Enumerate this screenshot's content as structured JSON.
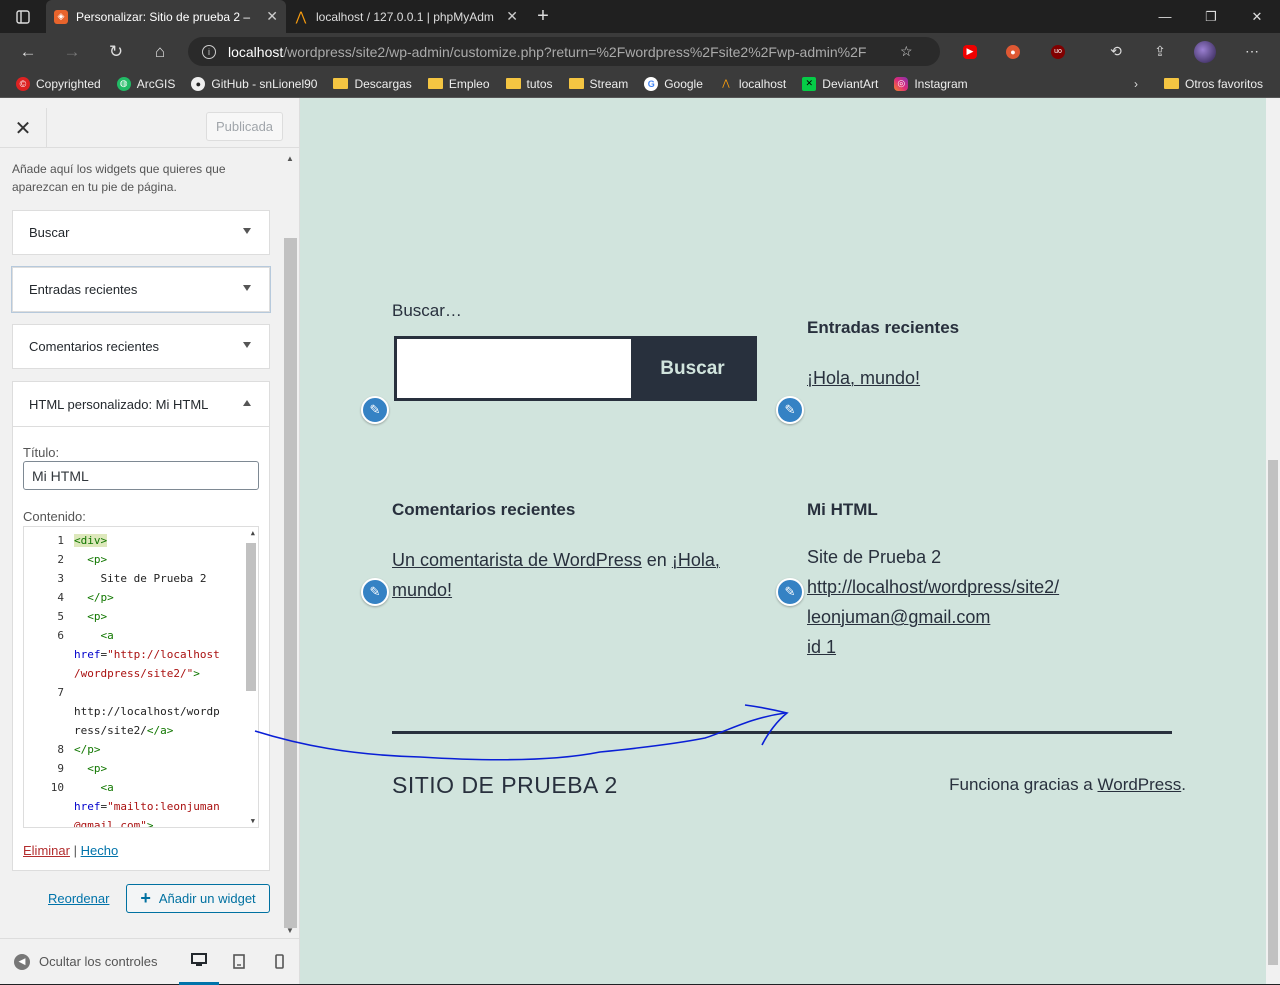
{
  "browser": {
    "tabs": [
      {
        "title": "Personalizar: Sitio de prueba 2 – ",
        "icon": "customizer-icon",
        "active": true
      },
      {
        "title": "localhost / 127.0.0.1 | phpMyAdm",
        "icon": "phpmyadmin-icon",
        "active": false
      }
    ],
    "url_host": "localhost",
    "url_path": "/wordpress/site2/wp-admin/customize.php?return=%2Fwordpress%2Fsite2%2Fwp-admin%2F",
    "bookmarks": [
      "Copyrighted",
      "ArcGIS",
      "GitHub - snLionel90",
      "Descargas",
      "Empleo",
      "tutos",
      "Stream",
      "Google",
      "localhost",
      "DeviantArt",
      "Instagram"
    ],
    "other_favorites": "Otros favoritos"
  },
  "panel": {
    "publish_label": "Publicada",
    "description": "Añade aquí los widgets que quieres que aparezcan en tu pie de página.",
    "widgets": [
      "Buscar",
      "Entradas recientes",
      "Comentarios recientes"
    ],
    "open_widget": {
      "title": "HTML personalizado: Mi HTML",
      "title_label": "Título:",
      "title_value": "Mi HTML",
      "content_label": "Contenido:",
      "code_line_numbers": [
        "1",
        "2",
        "3",
        "4",
        "5",
        "6",
        "",
        "7",
        "",
        "8",
        "9",
        "10",
        ""
      ],
      "delete_label": "Eliminar",
      "separator": "|",
      "done_label": "Hecho"
    },
    "reorder_label": "Reordenar",
    "add_widget_label": "Añadir un widget",
    "hide_controls_label": "Ocultar los controles"
  },
  "preview": {
    "search_title": "Buscar…",
    "search_button": "Buscar",
    "recent_posts_title": "Entradas recientes",
    "recent_post_link": "¡Hola, mundo!",
    "recent_comments_title": "Comentarios recientes",
    "comment_author": "Un comentarista de WordPress",
    "comment_on": "en",
    "comment_post_1": "¡Hola,",
    "comment_post_2": "mundo!",
    "html_title": "Mi HTML",
    "html_lines": [
      "Site de Prueba 2",
      "http://localhost/wordpress/site2/",
      "leonjuman@gmail.com",
      "id 1"
    ],
    "site_name": "SITIO DE PRUEBA 2",
    "powered_prefix": "Funciona gracias a",
    "powered_link": "WordPress",
    "powered_suffix": "."
  }
}
